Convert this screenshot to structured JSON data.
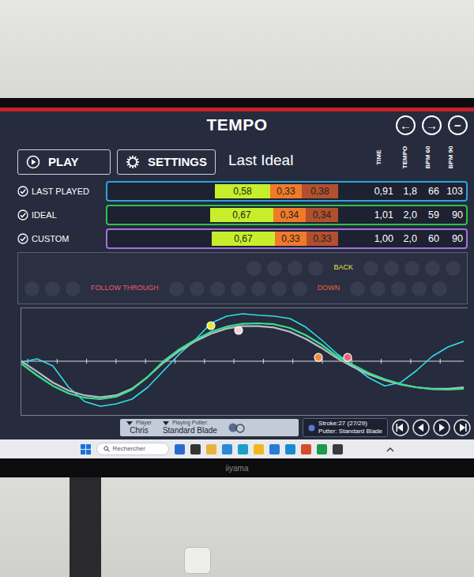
{
  "screen": {
    "title": "TEMPO",
    "nav": [
      "←",
      "→",
      "−"
    ],
    "buttons": [
      "PLAY",
      "SETTINGS"
    ],
    "mode_label": "Last Ideal"
  },
  "columns": [
    "TIME",
    "TEMPO",
    "BPM 60",
    "BPM 90"
  ],
  "rows": [
    {
      "label": "LAST PLAYED",
      "checked": true,
      "color": "#2ba4dc",
      "segments": [
        "0,58",
        "0,33",
        "0,38"
      ],
      "stats": [
        "0,91",
        "1,8",
        "66",
        "103"
      ]
    },
    {
      "label": "IDEAL",
      "checked": true,
      "color": "#2cc24c",
      "segments": [
        "0,67",
        "0,34",
        "0,34"
      ],
      "stats": [
        "1,01",
        "2,0",
        "59",
        "90"
      ]
    },
    {
      "label": "CUSTOM",
      "checked": true,
      "color": "#a274d8",
      "segments": [
        "0,67",
        "0,33",
        "0,33"
      ],
      "stats": [
        "1,00",
        "2,0",
        "60",
        "90"
      ]
    }
  ],
  "timeline": {
    "rows": [
      [
        {
          "kind": "dot",
          "lit": false
        },
        {
          "kind": "dot",
          "lit": false
        },
        {
          "kind": "dot",
          "lit": false
        },
        {
          "kind": "dot",
          "lit": false
        },
        {
          "kind": "label",
          "text": "BACK",
          "color": "#f0e040"
        },
        {
          "kind": "dot",
          "lit": false
        },
        {
          "kind": "dot",
          "lit": false
        },
        {
          "kind": "dot",
          "lit": false
        },
        {
          "kind": "dot",
          "lit": false
        },
        {
          "kind": "dot",
          "lit": false
        }
      ],
      [
        {
          "kind": "dot",
          "lit": false
        },
        {
          "kind": "dot",
          "lit": false
        },
        {
          "kind": "dot",
          "lit": false
        },
        {
          "kind": "label",
          "text": "FOLLOW THROUGH",
          "color": "#f05a6a"
        },
        {
          "kind": "dot",
          "lit": false
        },
        {
          "kind": "dot",
          "lit": false
        },
        {
          "kind": "dot",
          "lit": false
        },
        {
          "kind": "dot",
          "lit": false
        },
        {
          "kind": "dot",
          "lit": false
        },
        {
          "kind": "dot",
          "lit": false
        },
        {
          "kind": "dot",
          "lit": false
        },
        {
          "kind": "label",
          "text": "DOWN",
          "color": "#f2603a"
        },
        {
          "kind": "dot",
          "lit": false
        },
        {
          "kind": "dot",
          "lit": false
        },
        {
          "kind": "dot",
          "lit": false
        },
        {
          "kind": "dot",
          "lit": false
        },
        {
          "kind": "dot",
          "lit": false
        }
      ]
    ]
  },
  "chart": {
    "series": [
      {
        "color": "#2ee0e6",
        "values": [
          -0.02,
          0.05,
          -0.1,
          -0.55,
          -0.85,
          -0.95,
          -0.9,
          -0.8,
          -0.55,
          -0.2,
          0.15,
          0.45,
          0.8,
          0.95,
          1.0,
          0.97,
          0.95,
          0.9,
          0.72,
          0.45,
          0.15,
          -0.1,
          -0.35,
          -0.52,
          -0.45,
          -0.2,
          0.1,
          0.3,
          0.42
        ]
      },
      {
        "color": "#b8bcc8",
        "values": [
          0.0,
          -0.22,
          -0.45,
          -0.62,
          -0.72,
          -0.76,
          -0.72,
          -0.58,
          -0.33,
          -0.03,
          0.22,
          0.42,
          0.58,
          0.69,
          0.74,
          0.74,
          0.71,
          0.62,
          0.47,
          0.28,
          0.06,
          -0.12,
          -0.28,
          -0.4,
          -0.49,
          -0.55,
          -0.58,
          -0.58,
          -0.55
        ]
      },
      {
        "color": "#36e08a",
        "values": [
          -0.05,
          -0.3,
          -0.52,
          -0.68,
          -0.77,
          -0.8,
          -0.75,
          -0.6,
          -0.33,
          0.0,
          0.25,
          0.45,
          0.62,
          0.73,
          0.79,
          0.8,
          0.78,
          0.7,
          0.55,
          0.35,
          0.1,
          -0.08,
          -0.25,
          -0.38,
          -0.48,
          -0.55,
          -0.59,
          -0.6,
          -0.58
        ]
      }
    ],
    "markers": [
      {
        "x": 240,
        "value": 0.75,
        "color": "#e4e640"
      },
      {
        "x": 275,
        "value": 0.65,
        "color": "#f6d2d8"
      },
      {
        "x": 376,
        "value": 0.08,
        "color": "#f08a3a"
      },
      {
        "x": 413,
        "value": 0.08,
        "color": "#f0607a"
      }
    ]
  },
  "footer": {
    "player_label": "Player",
    "player": "Chris",
    "putter_label": "Playing Putter:",
    "putter": "Standard Blade",
    "stroke": "Stroke:27 (27/29)",
    "stroke_putter": "Putter: Standard Blade"
  },
  "taskbar": {
    "search_placeholder": "Rechercher"
  },
  "monitor": {
    "brand": "iiyama"
  }
}
